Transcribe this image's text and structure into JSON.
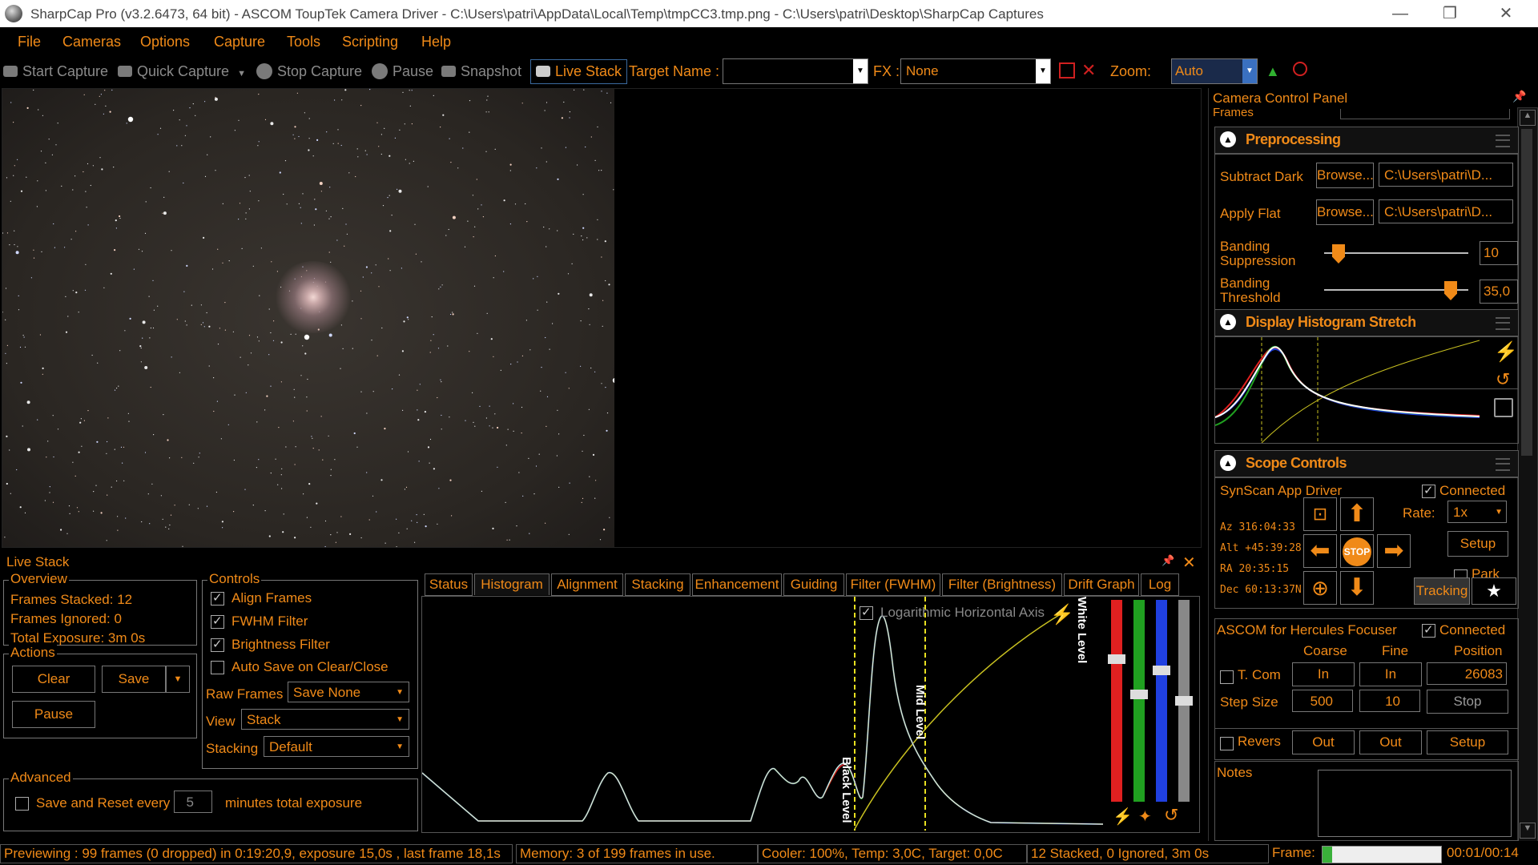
{
  "window": {
    "title": "SharpCap Pro (v3.2.6473, 64 bit) - ASCOM ToupTek Camera Driver - C:\\Users\\patri\\AppData\\Local\\Temp\\tmpCC3.tmp.png - C:\\Users\\patri\\Desktop\\SharpCap Captures",
    "minimize": "—",
    "restore": "❐",
    "close": "✕"
  },
  "menu": [
    "File",
    "Cameras",
    "Options",
    "Capture",
    "Tools",
    "Scripting",
    "Help"
  ],
  "toolbar": {
    "start_capture": "Start Capture",
    "quick_capture": "Quick Capture",
    "stop_capture": "Stop Capture",
    "pause": "Pause",
    "snapshot": "Snapshot",
    "live_stack": "Live Stack",
    "target_name_label": "Target Name :",
    "target_name_value": "",
    "fx_label": "FX :",
    "fx_value": "None",
    "zoom_label": "Zoom:",
    "zoom_value": "Auto"
  },
  "ccp": {
    "title": "Camera Control Panel",
    "frames_label": "Frames",
    "preprocessing": {
      "title": "Preprocessing",
      "subtract_dark": "Subtract Dark",
      "apply_flat": "Apply Flat",
      "browse": "Browse...",
      "dark_path": "C:\\Users\\patri\\D...",
      "flat_path": "C:\\Users\\patri\\D...",
      "banding_suppression": "Banding Suppression",
      "banding_suppression_value": "10",
      "banding_threshold": "Banding Threshold",
      "banding_threshold_value": "35,0"
    },
    "histogram_stretch": {
      "title": "Display Histogram Stretch"
    },
    "scope": {
      "title": "Scope Controls",
      "driver": "SynScan App Driver",
      "connected": "Connected",
      "az": "Az 316:04:33",
      "alt": "Alt +45:39:28",
      "ra": "RA 20:35:15",
      "dec": "Dec 60:13:37N",
      "rate_label": "Rate:",
      "rate_value": "1x",
      "setup": "Setup",
      "park": "Park",
      "stop": "STOP",
      "tracking": "Tracking"
    },
    "focuser": {
      "title": "ASCOM for Hercules Focuser",
      "connected": "Connected",
      "coarse": "Coarse",
      "fine": "Fine",
      "position": "Position",
      "tcom": "T. Com",
      "in": "In",
      "position_value": "26083",
      "step_size": "Step Size",
      "step_coarse": "500",
      "step_fine": "10",
      "stop": "Stop",
      "reverse": "Revers",
      "out": "Out",
      "setup": "Setup"
    },
    "notes": "Notes"
  },
  "livestack": {
    "title": "Live Stack",
    "overview": {
      "title": "Overview",
      "frames_stacked": "Frames Stacked:  12",
      "frames_ignored": "Frames Ignored:  0",
      "total_exposure": "Total Exposure:   3m 0s"
    },
    "actions": {
      "title": "Actions",
      "clear": "Clear",
      "save": "Save",
      "pause": "Pause"
    },
    "advanced": {
      "title": "Advanced",
      "save_reset": "Save and Reset every",
      "minutes_value": "5",
      "minutes_label": "minutes total exposure"
    },
    "controls": {
      "title": "Controls",
      "align_frames": "Align Frames",
      "fwhm_filter": "FWHM Filter",
      "brightness_filter": "Brightness Filter",
      "auto_save": "Auto Save on Clear/Close",
      "raw_frames_label": "Raw Frames",
      "raw_frames_value": "Save None",
      "view_label": "View",
      "view_value": "Stack",
      "stacking_label": "Stacking",
      "stacking_value": "Default"
    },
    "tabs": [
      "Status",
      "Histogram",
      "Alignment",
      "Stacking",
      "Enhancement",
      "Guiding",
      "Filter (FWHM)",
      "Filter (Brightness)",
      "Drift Graph",
      "Log"
    ],
    "histogram": {
      "log_axis": "Logarithmic Horizontal Axis",
      "black_level": "Black Level",
      "mid_level": "Mid Level",
      "white_level": "White Level"
    }
  },
  "status": {
    "previewing": "Previewing : 99 frames (0 dropped) in 0:19:20,9, exposure 15,0s , last frame 18,1s",
    "memory": "Memory: 3 of 199 frames in use.",
    "cooler": "Cooler: 100%, Temp: 3,0C, Target: 0,0C",
    "stacked": "12 Stacked, 0 Ignored, 3m 0s",
    "frame_label": "Frame:",
    "frame_time": "00:01/00:14",
    "frame_progress": 0.08
  },
  "colors": {
    "accent": "#f08a18",
    "background": "#000000",
    "red_channel": "#e02020",
    "green_channel": "#20a020",
    "blue_channel": "#2040e0",
    "level_marker": "#e8e020"
  }
}
